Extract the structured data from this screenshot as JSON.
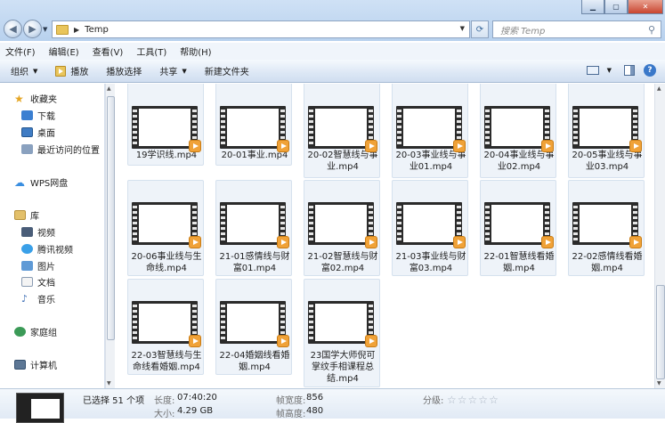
{
  "window": {
    "address": {
      "path": [
        "Temp"
      ]
    },
    "search": {
      "placeholder": "搜索 Temp"
    }
  },
  "menubar": {
    "items": [
      "文件(F)",
      "编辑(E)",
      "查看(V)",
      "工具(T)",
      "帮助(H)"
    ]
  },
  "toolbar": {
    "organize": "组织",
    "play": "播放",
    "play_all": "播放选择",
    "share": "共享",
    "new_folder": "新建文件夹"
  },
  "navigation": {
    "favorites": {
      "label": "收藏夹",
      "items": [
        "下载",
        "桌面",
        "最近访问的位置"
      ]
    },
    "wps": "WPS网盘",
    "libraries": {
      "label": "库",
      "items": [
        "视频",
        "腾讯视频",
        "图片",
        "文档",
        "音乐"
      ]
    },
    "homegroup": "家庭组",
    "computer": "计算机"
  },
  "files": [
    {
      "lines": [
        "19学识线.mp4"
      ]
    },
    {
      "lines": [
        "20-01事业.mp4"
      ]
    },
    {
      "lines": [
        "20-02智慧线与事",
        "业.mp4"
      ]
    },
    {
      "lines": [
        "20-03事业线与事",
        "业01.mp4"
      ]
    },
    {
      "lines": [
        "20-04事业线与事",
        "业02.mp4"
      ]
    },
    {
      "lines": [
        "20-05事业线与事",
        "业03.mp4"
      ]
    },
    {
      "lines": [
        "20-06事业线与生",
        "命线.mp4"
      ]
    },
    {
      "lines": [
        "21-01感情线与财",
        "富01.mp4"
      ]
    },
    {
      "lines": [
        "21-02智慧线与财",
        "富02.mp4"
      ]
    },
    {
      "lines": [
        "21-03事业线与财",
        "富03.mp4"
      ]
    },
    {
      "lines": [
        "22-01智慧线看婚",
        "姻.mp4"
      ]
    },
    {
      "lines": [
        "22-02感情线看婚",
        "姻.mp4"
      ]
    },
    {
      "lines": [
        "22-03智慧线与生",
        "命线看婚姻.mp4"
      ]
    },
    {
      "lines": [
        "22-04婚姻线看婚",
        "姻.mp4"
      ]
    },
    {
      "lines": [
        "23国学大师倪可",
        "掌纹手相课程总",
        "结.mp4"
      ]
    }
  ],
  "details": {
    "selected": "已选择 51 个项",
    "length_label": "长度:",
    "length_value": "07:40:20",
    "size_label": "大小:",
    "size_value": "4.29 GB",
    "frame_width_label": "帧宽度:",
    "frame_width_value": "856",
    "frame_height_label": "帧高度:",
    "frame_height_value": "480",
    "rating_label": "分级:",
    "rating_stars": 0
  }
}
